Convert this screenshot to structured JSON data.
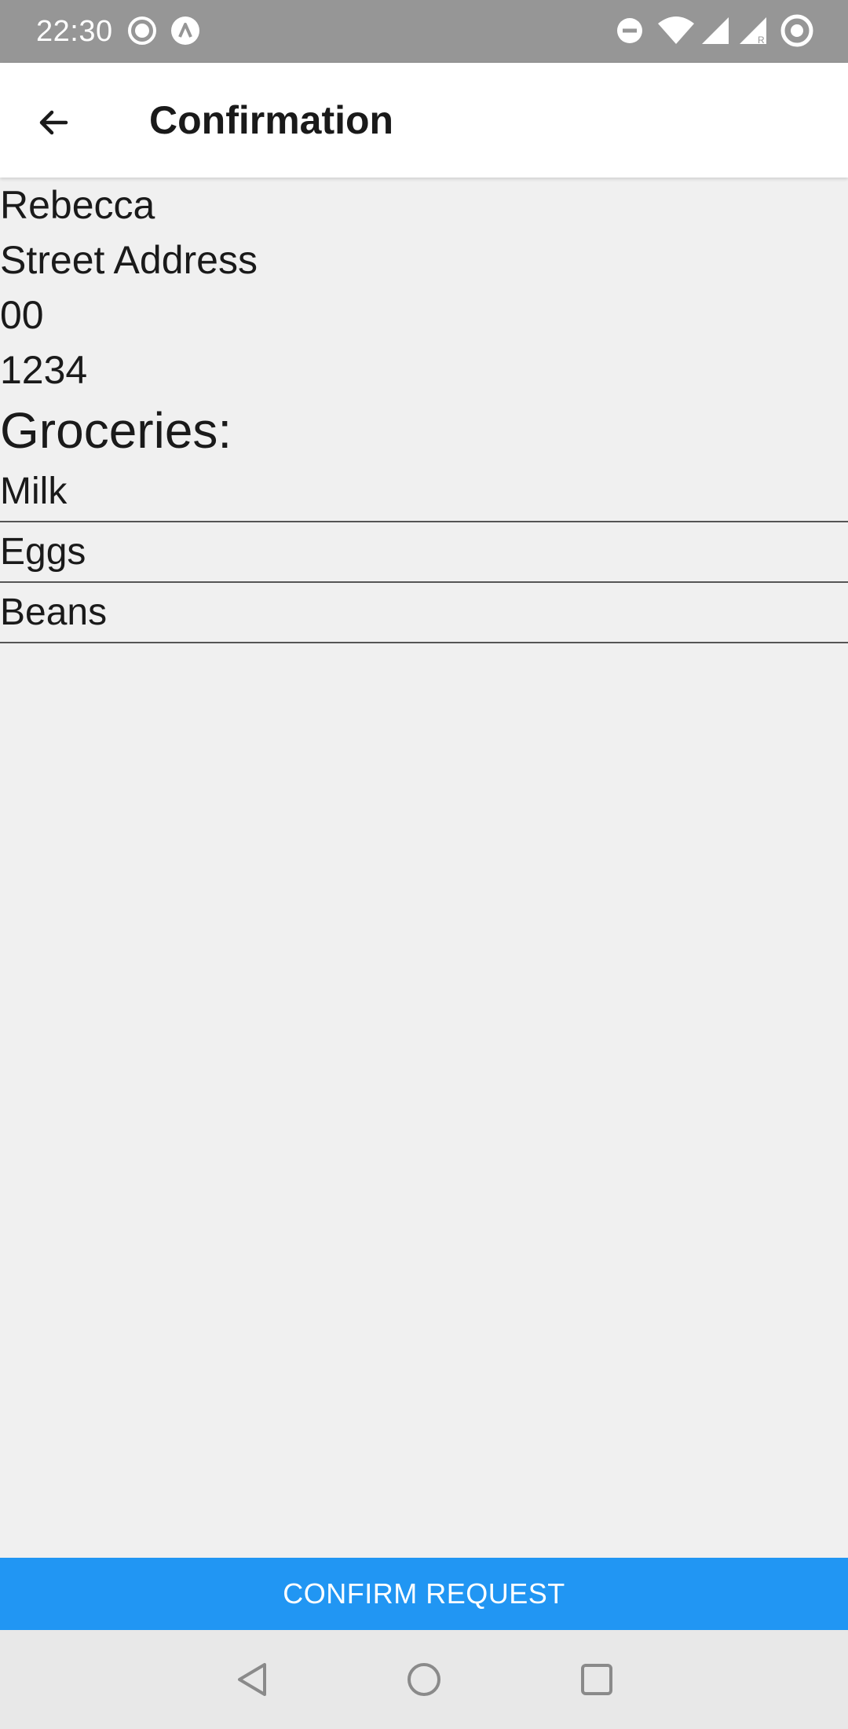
{
  "status_bar": {
    "time": "22:30",
    "left_icons": [
      "record-icon",
      "app-notification-icon"
    ],
    "right_icons": [
      "do-not-disturb-icon",
      "wifi-icon",
      "signal-icon",
      "signal-roaming-icon",
      "battery-icon"
    ]
  },
  "app_bar": {
    "title": "Confirmation",
    "back_icon": "arrow-back-icon"
  },
  "recipient": {
    "name": "Rebecca",
    "street": "Street Address",
    "unit": "00",
    "code": "1234"
  },
  "groceries": {
    "heading": "Groceries:",
    "items": [
      "Milk",
      "Eggs",
      "Beans"
    ]
  },
  "actions": {
    "confirm_label": "CONFIRM REQUEST"
  },
  "colors": {
    "status_bar": "#969696",
    "accent": "#2196f3",
    "background": "#f0f0f0"
  },
  "nav_bar": {
    "buttons": [
      "back-triangle-icon",
      "home-circle-icon",
      "recents-square-icon"
    ]
  }
}
